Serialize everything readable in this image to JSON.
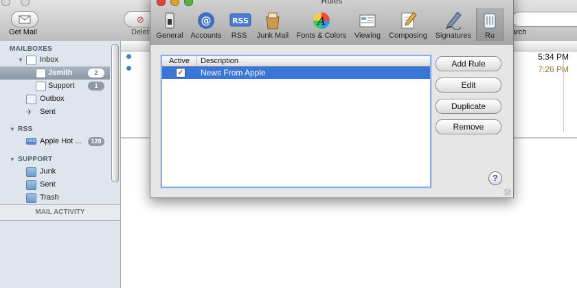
{
  "mail": {
    "toolbar": {
      "get_mail": "Get Mail",
      "delete": "Delet",
      "search": "arch"
    },
    "sidebar": {
      "mailboxes_header": "MAILBOXES",
      "inbox": "Inbox",
      "accounts": [
        {
          "label": "Jsmith",
          "badge": "2"
        },
        {
          "label": "Support",
          "badge": "1"
        }
      ],
      "outbox": "Outbox",
      "sent": "Sent",
      "rss_header": "RSS",
      "rss_feed": {
        "label": "Apple Hot ...",
        "badge": "128"
      },
      "support_header": "SUPPORT",
      "support_folders": [
        "Junk",
        "Sent",
        "Trash"
      ],
      "mail_activity": "MAIL ACTIVITY"
    },
    "messages": [
      {
        "time": "5:34 PM",
        "color": "#111111"
      },
      {
        "time": "7:26 PM",
        "color": "#9a7a2e"
      }
    ]
  },
  "dialog": {
    "title": "Rules",
    "tabs": [
      {
        "label": "General",
        "icon": "switch-icon"
      },
      {
        "label": "Accounts",
        "icon": "at-sign-icon"
      },
      {
        "label": "RSS",
        "icon": "rss-icon"
      },
      {
        "label": "Junk Mail",
        "icon": "junk-mail-icon"
      },
      {
        "label": "Fonts & Colors",
        "icon": "fonts-colors-icon"
      },
      {
        "label": "Viewing",
        "icon": "viewing-icon"
      },
      {
        "label": "Composing",
        "icon": "composing-icon"
      },
      {
        "label": "Signatures",
        "icon": "signatures-icon"
      },
      {
        "label": "Ru",
        "icon": "rules-icon",
        "active": true
      }
    ],
    "rules_table": {
      "columns": [
        "Active",
        "Description"
      ],
      "rows": [
        {
          "active": true,
          "check_glyph": "✓",
          "description": "News From Apple"
        }
      ]
    },
    "buttons": {
      "add_rule": "Add Rule",
      "edit": "Edit",
      "duplicate": "Duplicate",
      "remove": "Remove",
      "help": "?"
    },
    "colors": {
      "selection": "#3a76d6",
      "close": "#e0443e",
      "minimize": "#d9a531",
      "zoom": "#5bb33f"
    }
  }
}
